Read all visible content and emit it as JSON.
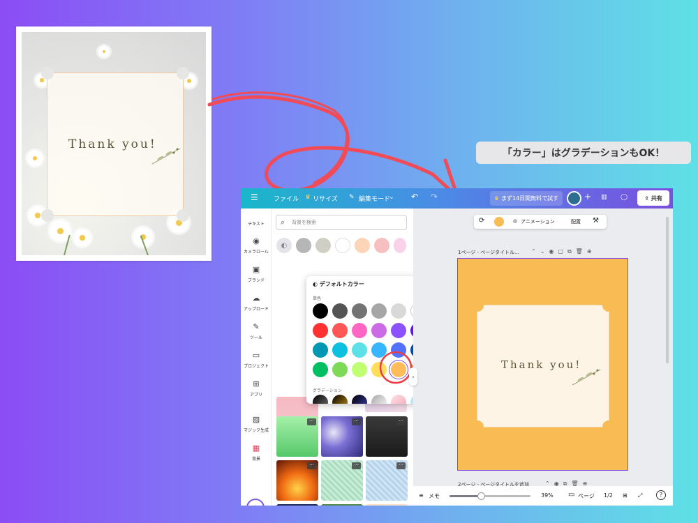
{
  "photo_card": {
    "text": "Thank you!"
  },
  "callout": {
    "text": "「カラー」はグラデーションもOK！"
  },
  "topbar": {
    "menu_icon": "menu-icon",
    "file": "ファイル",
    "resize": "リサイズ",
    "edit_mode": "編集モード",
    "trial": "まず14日間無料で試す",
    "share": "共有"
  },
  "rail": {
    "items": [
      {
        "label": "テキスト",
        "icon": "text-icon"
      },
      {
        "label": "カメラロール",
        "icon": "camera-icon"
      },
      {
        "label": "ブランド",
        "icon": "brand-icon"
      },
      {
        "label": "アップロード",
        "icon": "upload-icon"
      },
      {
        "label": "ツール",
        "icon": "pen-icon"
      },
      {
        "label": "プロジェクト",
        "icon": "folder-icon"
      },
      {
        "label": "アプリ",
        "icon": "apps-icon"
      },
      {
        "label": "マジック生成",
        "icon": "magic-image-icon"
      },
      {
        "label": "背景",
        "icon": "background-icon"
      }
    ]
  },
  "panel": {
    "search_placeholder": "背景を検索",
    "top_swatches": [
      "#b6b6b6",
      "#cfcfc5",
      "#ffffff",
      "#fcd5b8",
      "#f7c0c0",
      "#f9d2ea"
    ],
    "popup": {
      "title": "デフォルトカラー",
      "solid_label": "単色",
      "gradient_label": "グラデーション",
      "solid_colors": [
        [
          "#000000",
          "#545454",
          "#737373",
          "#a6a6a6",
          "#d9d9d9",
          "#ffffff"
        ],
        [
          "#ff3131",
          "#ff5757",
          "#ff66c4",
          "#cb6ce6",
          "#8c52ff",
          "#5e17eb"
        ],
        [
          "#0097b2",
          "#0cc0df",
          "#5ce1e6",
          "#38b6ff",
          "#5271ff",
          "#004aad"
        ],
        [
          "#00bf63",
          "#7ed957",
          "#c1ff72",
          "#ffde59",
          "#ffbd59",
          "#ff914d"
        ]
      ],
      "selected_color": "#ffbd59"
    }
  },
  "canvas": {
    "context_bar": {
      "animation": "アニメーション",
      "arrange": "配置",
      "color": "#f9bb54"
    },
    "page1_label": "1ページ - ページタイトル...",
    "page1_text": "Thank you!",
    "page2_label": "2ページ - ページタイトルを追加"
  },
  "bottombar": {
    "notes": "メモ",
    "zoom": "39%",
    "zoom_fraction": 0.39,
    "pages": "ページ",
    "page_count": "1/2",
    "help": "?"
  }
}
